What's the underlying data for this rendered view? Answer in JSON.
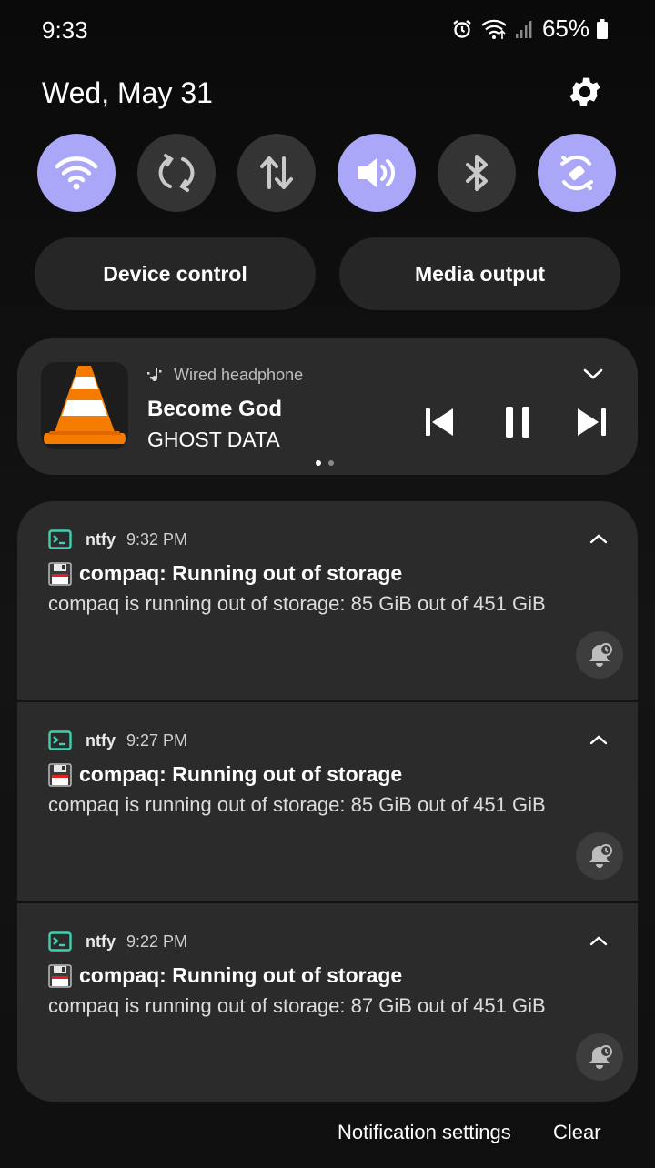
{
  "status_bar": {
    "time": "9:33",
    "battery": "65%",
    "icons": [
      "alarm-icon",
      "wifi-icon",
      "signal-icon",
      "battery-icon"
    ]
  },
  "date": "Wed, May 31",
  "quick_tiles": [
    {
      "name": "wifi",
      "state": "on"
    },
    {
      "name": "auto-rotate",
      "state": "off"
    },
    {
      "name": "mobile-data",
      "state": "off"
    },
    {
      "name": "sound",
      "state": "on"
    },
    {
      "name": "bluetooth",
      "state": "off"
    },
    {
      "name": "rotation-lock",
      "state": "on"
    }
  ],
  "pills": {
    "device_control": "Device control",
    "media_output": "Media output"
  },
  "media": {
    "output": "Wired headphone",
    "title": "Become God",
    "artist": "GHOST DATA",
    "app_icon": "vlc-cone-icon"
  },
  "notifications": [
    {
      "app": "ntfy",
      "time": "9:32 PM",
      "title": "compaq: Running out of storage",
      "body": "compaq is running out of storage: 85 GiB out of 451 GiB"
    },
    {
      "app": "ntfy",
      "time": "9:27 PM",
      "title": "compaq: Running out of storage",
      "body": "compaq is running out of storage: 85 GiB out of 451 GiB"
    },
    {
      "app": "ntfy",
      "time": "9:22 PM",
      "title": "compaq: Running out of storage",
      "body": "compaq is running out of storage: 87 GiB out of 451 GiB"
    }
  ],
  "footer": {
    "settings": "Notification settings",
    "clear": "Clear"
  },
  "colors": {
    "tile_on": "#aaa6f8",
    "tile_off": "#343434",
    "card": "#2b2b2b",
    "ntfy_teal": "#3ed1b0"
  }
}
